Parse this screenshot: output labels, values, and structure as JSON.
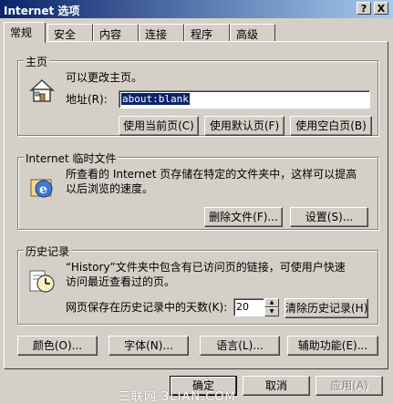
{
  "window": {
    "title": "Internet 选项",
    "help_btn": "?",
    "close_btn": "X"
  },
  "tabs": [
    {
      "label": "常规"
    },
    {
      "label": "安全"
    },
    {
      "label": "内容"
    },
    {
      "label": "连接"
    },
    {
      "label": "程序"
    },
    {
      "label": "高级"
    }
  ],
  "homepage": {
    "group_label": "主页",
    "desc": "可以更改主页。",
    "address_label": "地址(R):",
    "address_value": "about:blank",
    "btn_current": "使用当前页(C)",
    "btn_default": "使用默认页(F)",
    "btn_blank": "使用空白页(B)"
  },
  "temp_files": {
    "group_label": "Internet 临时文件",
    "desc_line1": "所查看的 Internet 页存储在特定的文件夹中，这样可以提高",
    "desc_line2": "以后浏览的速度。",
    "btn_delete": "删除文件(F)...",
    "btn_settings": "设置(S)..."
  },
  "history": {
    "group_label": "历史记录",
    "desc_line1": "“History”文件夹中包含有已访问页的链接，可使用户快速",
    "desc_line2": "访问最近查看过的页。",
    "days_label": "网页保存在历史记录中的天数(K):",
    "days_value": "20",
    "btn_clear": "清除历史记录(H)"
  },
  "bottom_buttons": {
    "colors": "颜色(O)...",
    "fonts": "字体(N)...",
    "languages": "语言(L)...",
    "accessibility": "辅助功能(E)..."
  },
  "dialog_buttons": {
    "ok": "确定",
    "cancel": "取消",
    "apply": "应用(A)"
  },
  "watermark": "三联网 3LIAN.COM",
  "colors": {
    "face": "#d4d0c8",
    "title_start": "#0a246a",
    "title_end": "#a6caf0",
    "selection": "#0a246a"
  },
  "icons": {
    "homepage": "house-icon",
    "temp_files": "ie-globe-icon",
    "history": "history-clock-icon"
  }
}
